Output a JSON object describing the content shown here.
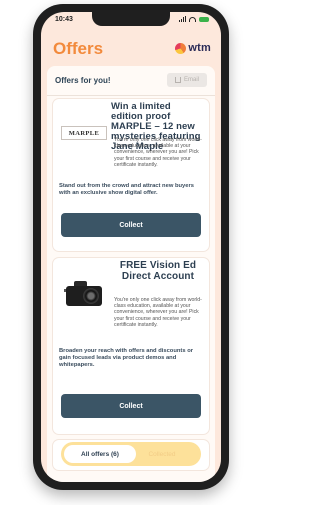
{
  "status_bar": {
    "time": "10:43"
  },
  "header": {
    "title": "Offers",
    "logo_text": "wtm"
  },
  "offers_section": {
    "heading": "Offers for you!",
    "email_button_label": "Email"
  },
  "offers": [
    {
      "image_label": "MARPLE",
      "title": "Win a limited edition proof MARPLE – 12 new mysteries featuring Jane Maple",
      "description": "You're only one click away from world-class education, available at your convenience, wherever you are! Pick your first course and receive your certificate instantly.",
      "pitch": "Stand out from the crowd and attract new buyers with an exclusive show digital offer.",
      "button_label": "Collect"
    },
    {
      "title": "FREE Vision Ed Direct Account",
      "description": "You're only one click away from world-class education, available at your convenience, wherever you are! Pick your first course and receive your certificate instantly.",
      "pitch": "Broaden your reach with offers and discounts or gain focused leads via product demos and whitepapers.",
      "button_label": "Collect"
    }
  ],
  "tabs": {
    "all_offers": "All offers (6)",
    "collected": "Collected"
  },
  "icons": {
    "share": "share-icon",
    "logo": "wtm-logo-icon",
    "camera": "camera-image",
    "signal": "signal-icon",
    "wifi": "wifi-icon",
    "battery": "battery-icon"
  },
  "colors": {
    "accent": "#f28a3c",
    "button": "#3b5566",
    "tab_bar": "#fde19a",
    "screen_bg": "#fde8dc"
  }
}
